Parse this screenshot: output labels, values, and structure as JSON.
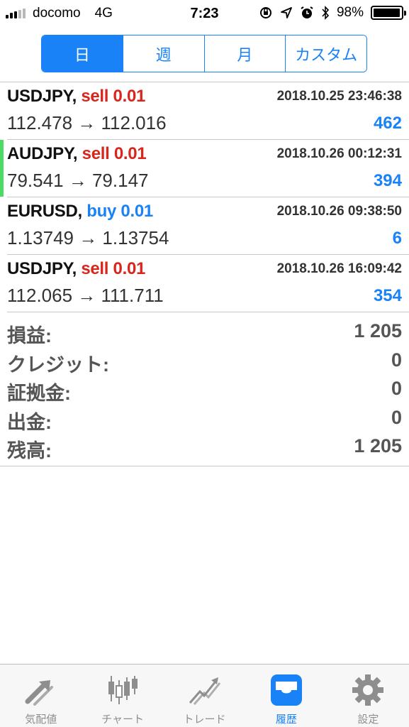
{
  "status_bar": {
    "carrier": "docomo",
    "network": "4G",
    "time": "7:23",
    "battery": "98%",
    "battery_level": 0.98
  },
  "segments": [
    {
      "label": "日",
      "active": true
    },
    {
      "label": "週",
      "active": false
    },
    {
      "label": "月",
      "active": false
    },
    {
      "label": "カスタム",
      "active": false
    }
  ],
  "trades": [
    {
      "symbol": "USDJPY,",
      "side": "sell 0.01",
      "side_type": "sell",
      "time": "2018.10.25 23:46:38",
      "prices": "112.478 → 112.016",
      "profit": "462",
      "highlighted": false
    },
    {
      "symbol": "AUDJPY,",
      "side": "sell 0.01",
      "side_type": "sell",
      "time": "2018.10.26 00:12:31",
      "prices": "79.541 → 79.147",
      "profit": "394",
      "highlighted": true
    },
    {
      "symbol": "EURUSD,",
      "side": "buy 0.01",
      "side_type": "buy",
      "time": "2018.10.26 09:38:50",
      "prices": "1.13749 → 1.13754",
      "profit": "6",
      "highlighted": false
    },
    {
      "symbol": "USDJPY,",
      "side": "sell 0.01",
      "side_type": "sell",
      "time": "2018.10.26 16:09:42",
      "prices": "112.065 → 111.711",
      "profit": "354",
      "highlighted": false
    }
  ],
  "summary": [
    {
      "label": "損益:",
      "value": "1 205"
    },
    {
      "label": "クレジット:",
      "value": "0"
    },
    {
      "label": "証拠金:",
      "value": "0"
    },
    {
      "label": "出金:",
      "value": "0"
    },
    {
      "label": "残高:",
      "value": "1 205"
    }
  ],
  "tabbar": {
    "items": [
      {
        "label": "気配値",
        "icon": "quotes-arrows-icon",
        "active": false
      },
      {
        "label": "チャート",
        "icon": "candlestick-chart-icon",
        "active": false
      },
      {
        "label": "トレード",
        "icon": "trade-chart-icon",
        "active": false
      },
      {
        "label": "履歴",
        "icon": "history-inbox-icon",
        "active": true
      },
      {
        "label": "設定",
        "icon": "gear-icon",
        "active": false
      }
    ]
  },
  "colors": {
    "accent": "#1a82f7",
    "sell": "#d9261c",
    "buy": "#1a82f7",
    "highlight_marker": "#4cd964"
  }
}
